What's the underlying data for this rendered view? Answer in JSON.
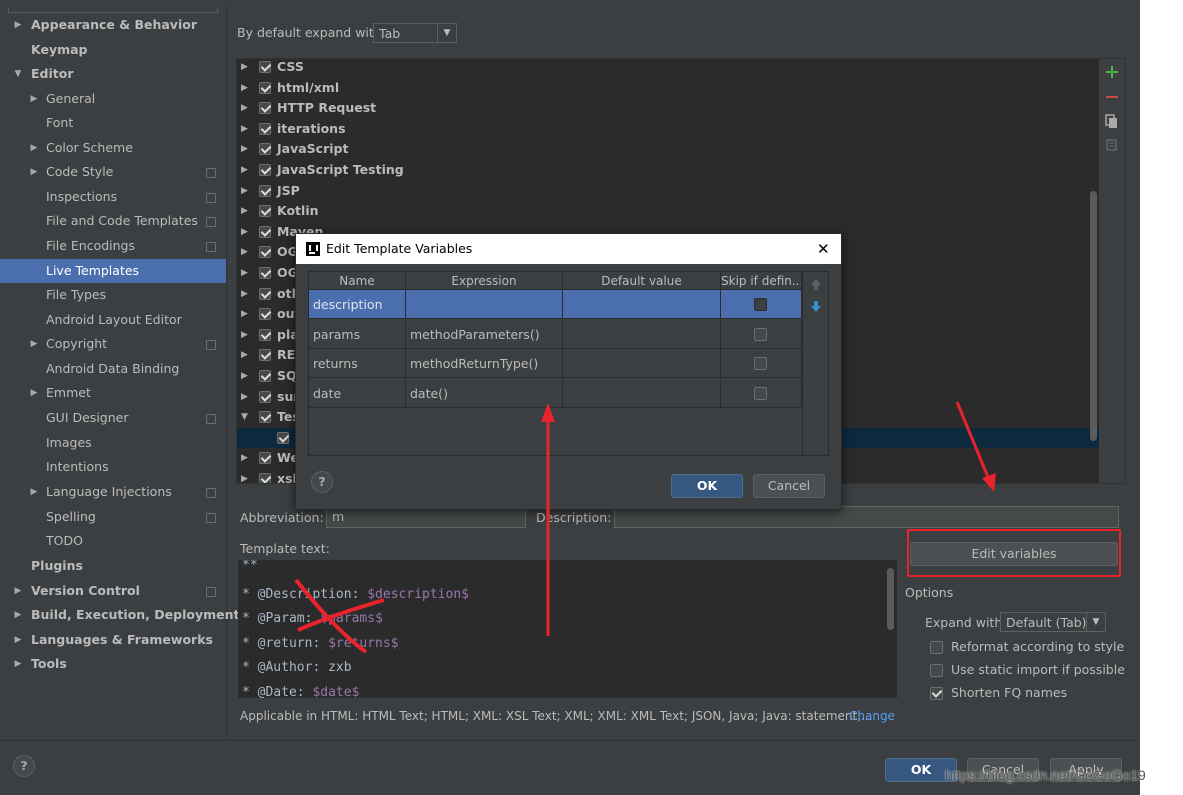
{
  "sidebar": {
    "items": [
      {
        "label": "Appearance & Behavior",
        "arrow": "▶",
        "bold": true,
        "proj": false
      },
      {
        "label": "Keymap",
        "arrow": "",
        "bold": true,
        "proj": false
      },
      {
        "label": "Editor",
        "arrow": "▼",
        "bold": true,
        "proj": false
      },
      {
        "label": "General",
        "arrow": "▶",
        "bold": false,
        "proj": false
      },
      {
        "label": "Font",
        "arrow": "",
        "bold": false,
        "proj": false
      },
      {
        "label": "Color Scheme",
        "arrow": "▶",
        "bold": false,
        "proj": false
      },
      {
        "label": "Code Style",
        "arrow": "▶",
        "bold": false,
        "proj": true
      },
      {
        "label": "Inspections",
        "arrow": "",
        "bold": false,
        "proj": true
      },
      {
        "label": "File and Code Templates",
        "arrow": "",
        "bold": false,
        "proj": true
      },
      {
        "label": "File Encodings",
        "arrow": "",
        "bold": false,
        "proj": true
      },
      {
        "label": "Live Templates",
        "arrow": "",
        "bold": false,
        "proj": false,
        "selected": true
      },
      {
        "label": "File Types",
        "arrow": "",
        "bold": false,
        "proj": false
      },
      {
        "label": "Android Layout Editor",
        "arrow": "",
        "bold": false,
        "proj": false
      },
      {
        "label": "Copyright",
        "arrow": "▶",
        "bold": false,
        "proj": true
      },
      {
        "label": "Android Data Binding",
        "arrow": "",
        "bold": false,
        "proj": false
      },
      {
        "label": "Emmet",
        "arrow": "▶",
        "bold": false,
        "proj": false
      },
      {
        "label": "GUI Designer",
        "arrow": "",
        "bold": false,
        "proj": true
      },
      {
        "label": "Images",
        "arrow": "",
        "bold": false,
        "proj": false
      },
      {
        "label": "Intentions",
        "arrow": "",
        "bold": false,
        "proj": false
      },
      {
        "label": "Language Injections",
        "arrow": "▶",
        "bold": false,
        "proj": true
      },
      {
        "label": "Spelling",
        "arrow": "",
        "bold": false,
        "proj": true
      },
      {
        "label": "TODO",
        "arrow": "",
        "bold": false,
        "proj": false
      },
      {
        "label": "Plugins",
        "arrow": "",
        "bold": true,
        "proj": false
      },
      {
        "label": "Version Control",
        "arrow": "▶",
        "bold": true,
        "proj": true
      },
      {
        "label": "Build, Execution, Deployment",
        "arrow": "▶",
        "bold": true,
        "proj": false
      },
      {
        "label": "Languages & Frameworks",
        "arrow": "▶",
        "bold": true,
        "proj": false
      },
      {
        "label": "Tools",
        "arrow": "▶",
        "bold": true,
        "proj": false
      }
    ]
  },
  "expand_default": {
    "label": "By default expand with",
    "value": "Tab"
  },
  "template_groups": [
    {
      "name": "CSS",
      "arrow": "▶"
    },
    {
      "name": "html/xml",
      "arrow": "▶"
    },
    {
      "name": "HTTP Request",
      "arrow": "▶"
    },
    {
      "name": "iterations",
      "arrow": "▶"
    },
    {
      "name": "JavaScript",
      "arrow": "▶"
    },
    {
      "name": "JavaScript Testing",
      "arrow": "▶"
    },
    {
      "name": "JSP",
      "arrow": "▶"
    },
    {
      "name": "Kotlin",
      "arrow": "▶"
    },
    {
      "name": "Maven",
      "arrow": "▶"
    },
    {
      "name": "OG",
      "arrow": "▶"
    },
    {
      "name": "OG",
      "arrow": "▶"
    },
    {
      "name": "oth",
      "arrow": "▶"
    },
    {
      "name": "out",
      "arrow": "▶"
    },
    {
      "name": "pla",
      "arrow": "▶"
    },
    {
      "name": "RES",
      "arrow": "▶"
    },
    {
      "name": "SQ",
      "arrow": "▶"
    },
    {
      "name": "sur",
      "arrow": "▶"
    },
    {
      "name": "Tes",
      "arrow": "▼"
    },
    {
      "name": "",
      "arrow": "",
      "child": true
    },
    {
      "name": "We",
      "arrow": "▶"
    },
    {
      "name": "xsl",
      "arrow": "▶"
    }
  ],
  "toolbar_icons": [
    "add-icon",
    "remove-icon",
    "copy-icon",
    "restore-icon"
  ],
  "abbreviation": {
    "label": "Abbreviation:",
    "value": "m"
  },
  "description": {
    "label": "Description:",
    "value": ""
  },
  "template_text_label": "Template text:",
  "template_lines": [
    {
      "plain": "**",
      "var": ""
    },
    {
      "plain": "* @Description: ",
      "var": "$description$"
    },
    {
      "plain": "* @Param: ",
      "var": "$params$"
    },
    {
      "plain": "* @return: ",
      "var": "$returns$"
    },
    {
      "plain": "* @Author: zxb",
      "var": ""
    },
    {
      "plain": "* @Date: ",
      "var": "$date$"
    }
  ],
  "edit_variables_button": "Edit variables",
  "options": {
    "title": "Options",
    "expand_label": "Expand with",
    "expand_value": "Default (Tab)",
    "checks": [
      {
        "label": "Reformat according to style",
        "checked": false
      },
      {
        "label": "Use static import if possible",
        "checked": false
      },
      {
        "label": "Shorten FQ names",
        "checked": true
      }
    ]
  },
  "applicable_text": "Applicable in HTML: HTML Text; HTML; XML: XSL Text; XML; XML: XML Text; JSON, Java; Java: statement,...",
  "change_link": "Change",
  "footer": {
    "ok": "OK",
    "cancel": "Cancel",
    "apply": "Apply",
    "help": "?"
  },
  "watermark": "https://blog.csdn.net/GoGoGo19",
  "dialog": {
    "title": "Edit Template Variables",
    "close": "✕",
    "columns": [
      "Name",
      "Expression",
      "Default value",
      "Skip if defin..."
    ],
    "rows": [
      {
        "name": "description",
        "expression": "",
        "default": "",
        "skip": false
      },
      {
        "name": "params",
        "expression": "methodParameters()",
        "default": "",
        "skip": false
      },
      {
        "name": "returns",
        "expression": "methodReturnType()",
        "default": "",
        "skip": false
      },
      {
        "name": "date",
        "expression": "date()",
        "default": "",
        "skip": false
      }
    ],
    "ok": "OK",
    "cancel": "Cancel",
    "help": "?"
  },
  "colors": {
    "annotation": "#e8232c",
    "selection": "#4b6eaf",
    "background": "#3c3f41"
  }
}
